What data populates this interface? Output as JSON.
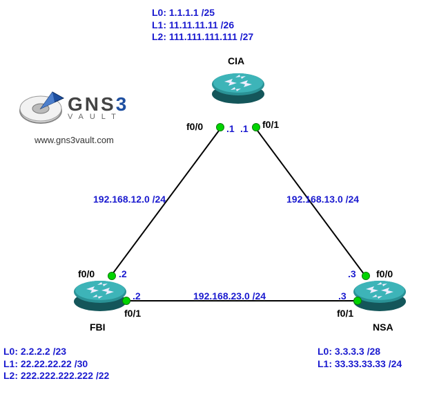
{
  "brand": {
    "name_gns": "GNS",
    "name_3": "3",
    "sub": "VAULT",
    "url": "www.gns3vault.com"
  },
  "routers": {
    "cia": {
      "name": "CIA",
      "loopbacks": "L0: 1.1.1.1 /25\nL1: 11.11.11.11 /26\nL2: 111.111.111.111 /27",
      "if_left": "f0/0",
      "if_right": "f0/1",
      "ip_left": ".1",
      "ip_right": ".1"
    },
    "fbi": {
      "name": "FBI",
      "loopbacks": "L0: 2.2.2.2 /23\nL1: 22.22.22.22 /30\nL2: 222.222.222.222 /22",
      "if_top": "f0/0",
      "if_right": "f0/1",
      "ip_top": ".2",
      "ip_right": ".2"
    },
    "nsa": {
      "name": "NSA",
      "loopbacks": "L0: 3.3.3.3 /28\nL1: 33.33.33.33 /24",
      "if_top": "f0/0",
      "if_left": "f0/1",
      "ip_top": ".3",
      "ip_left": ".3"
    }
  },
  "links": {
    "cia_fbi": "192.168.12.0 /24",
    "cia_nsa": "192.168.13.0 /24",
    "fbi_nsa": "192.168.23.0 /24"
  }
}
